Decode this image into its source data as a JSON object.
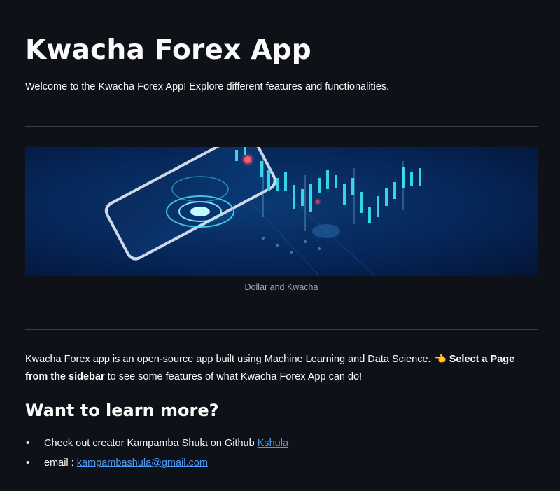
{
  "header": {
    "title": "Kwacha Forex App",
    "welcome": "Welcome to the Kwacha Forex App! Explore different features and functionalities."
  },
  "hero": {
    "caption": "Dollar and Kwacha",
    "icon": "smartphone-trading-chart-illustration"
  },
  "intro": {
    "text_before": "Kwacha Forex app is an open-source app built using Machine Learning and Data Science.",
    "pointing_emoji": "👈",
    "bold_text": "Select a Page from the sidebar",
    "text_after": "to see some features of what Kwacha Forex App can do!"
  },
  "learn_more": {
    "heading": "Want to learn more?",
    "items": [
      {
        "bullet": "•",
        "text": "Check out creator Kampamba Shula on Github",
        "link_label": "Kshula"
      },
      {
        "bullet": "•",
        "text": "email :",
        "link_label": "kampambashula@gmail.com"
      }
    ]
  },
  "colors": {
    "background": "#0e1117",
    "text": "#fafafa",
    "link": "#4c9bf6",
    "divider": "#3b3e47",
    "accent_cyan": "#2fe0e6",
    "accent_red": "#e8304a"
  }
}
